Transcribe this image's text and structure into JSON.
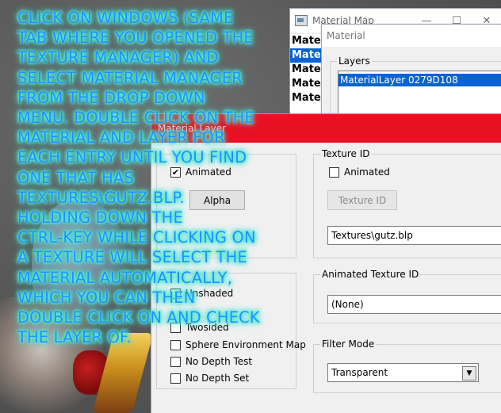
{
  "material_map": {
    "title": "Material Map",
    "controls": [
      "—",
      "☐",
      "✕"
    ],
    "list": [
      "Materi",
      "Mater",
      "Materi",
      "Materi",
      "Materi"
    ]
  },
  "material": {
    "title": "Material",
    "layers_label": "Layers",
    "layer_item": "MaterialLayer 0279D108"
  },
  "material_layer": {
    "title": "Material Layer",
    "left_checkbox_animated": "Animated",
    "alpha_button": "Alpha",
    "left_checks": [
      "Twosided",
      "Sphere Environment Map",
      "No Depth Test",
      "No Depth Set"
    ],
    "unshaded_label": "Unshaded",
    "texture_id_group": "Texture ID",
    "texture_id_animated": "Animated",
    "texture_id_button": "Texture ID",
    "texture_path": "Textures\\gutz.blp",
    "animated_texture_group": "Animated Texture ID",
    "animated_texture_value": "(None)",
    "filter_mode_group": "Filter Mode",
    "filter_mode_value": "Transparent"
  },
  "overlay": {
    "lines": [
      "CLICK ON WINDOWS (SAME",
      "TAB WHERE YOU OPENED THE",
      "TEXTURE MANAGER) AND",
      "SELECT MATERIAL MANAGER",
      "FROM THE DROP DOWN",
      "MENU. DOUBLE CLICK ON THE",
      "MATERIAL AND LAYER FOR",
      "EACH ENTRY UNTIL YOU FIND",
      "ONE THAT HAS",
      "TEXTURES\\GUTZ.BLP.",
      "HOLDING DOWN THE",
      "CTRL-KEY WHILE CLICKING ON",
      "A TEXTURE WILL SELECT THE",
      "MATERIAL AUTOMATICALLY,",
      "WHICH YOU CAN THEN",
      "DOUBLE CLICK ON AND CHECK",
      "THE LAYER OF."
    ]
  }
}
